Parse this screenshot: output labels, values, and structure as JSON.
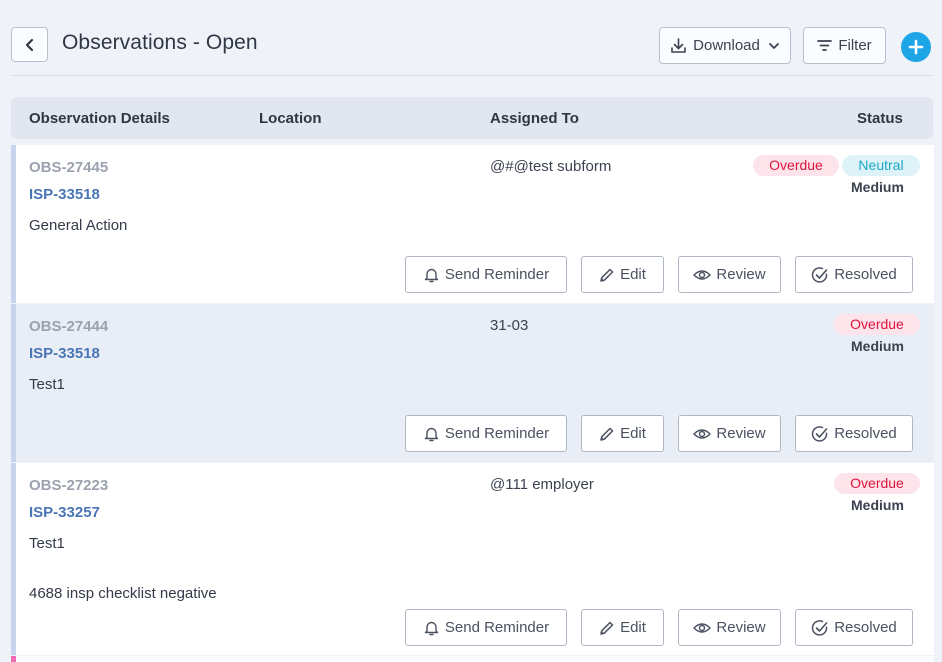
{
  "header": {
    "title": "Observations - Open",
    "download_label": "Download",
    "filter_label": "Filter"
  },
  "columns": {
    "details": "Observation Details",
    "location": "Location",
    "assigned": "Assigned To",
    "status": "Status"
  },
  "actions": {
    "remind": "Send Reminder",
    "edit": "Edit",
    "review": "Review",
    "resolved": "Resolved"
  },
  "rows": [
    {
      "obs_id": "OBS-27445",
      "isp_id": "ISP-33518",
      "desc": "General Action",
      "desc2": "",
      "assignee": "@#@test subform",
      "badges": [
        "Overdue",
        "Neutral"
      ],
      "priority": "Medium"
    },
    {
      "obs_id": "OBS-27444",
      "isp_id": "ISP-33518",
      "desc": "Test1",
      "desc2": "",
      "assignee": "31-03",
      "badges": [
        "Overdue"
      ],
      "priority": "Medium"
    },
    {
      "obs_id": "OBS-27223",
      "isp_id": "ISP-33257",
      "desc": "Test1",
      "desc2": "4688 insp checklist negative",
      "assignee": "@111 employer",
      "badges": [
        "Overdue"
      ],
      "priority": "Medium"
    }
  ],
  "colors": {
    "accent": "#1ea5e6",
    "overdue": "#e0133d",
    "neutral": "#1aa8c8",
    "link": "#4a76b5"
  }
}
